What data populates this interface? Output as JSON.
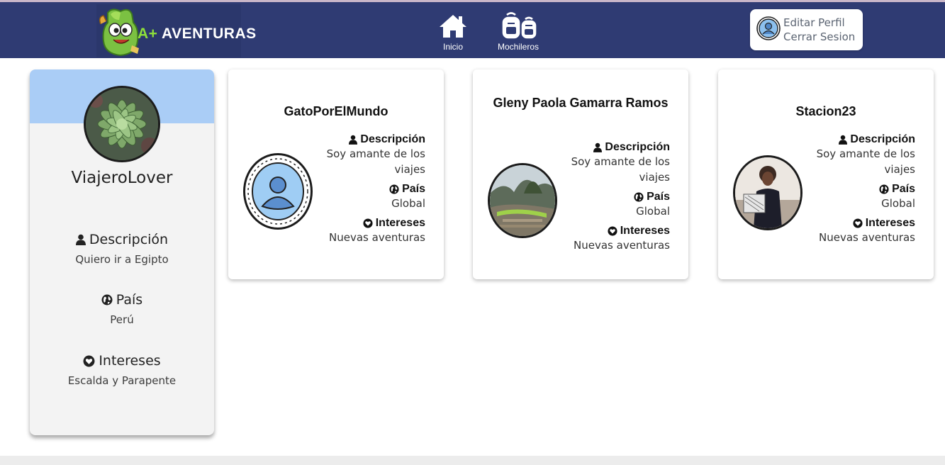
{
  "header": {
    "logo_text": "AVENTURAS",
    "logo_prefix": "A+",
    "nav": [
      {
        "label": "Inicio",
        "icon": "home-icon"
      },
      {
        "label": "Mochileros",
        "icon": "backpacks-icon"
      }
    ],
    "profile_menu": {
      "edit_label": "Editar Perfil",
      "logout_label": "Cerrar Sesion"
    }
  },
  "current_user": {
    "username": "ViajeroLover",
    "description_label": "Descripción",
    "description": "Quiero ir a Egipto",
    "country_label": "País",
    "country": "Perú",
    "interests_label": "Intereses",
    "interests": "Escalda y Parapente"
  },
  "travelers": [
    {
      "name": "GatoPorElMundo",
      "description_label": "Descripción",
      "description": "Soy amante de los viajes",
      "country_label": "País",
      "country": "Global",
      "interests_label": "Intereses",
      "interests": "Nuevas aventuras"
    },
    {
      "name": "Gleny Paola Gamarra Ramos",
      "description_label": "Descripción",
      "description": "Soy amante de los viajes",
      "country_label": "País",
      "country": "Global",
      "interests_label": "Intereses",
      "interests": "Nuevas aventuras"
    },
    {
      "name": "Stacion23",
      "description_label": "Descripción",
      "description": "Soy amante de los viajes",
      "country_label": "País",
      "country": "Global",
      "interests_label": "Intereses",
      "interests": "Nuevas aventuras"
    }
  ],
  "colors": {
    "navbar": "#2f3b73",
    "profile_band": "#aacdf6",
    "card_bg": "#ffffff"
  }
}
